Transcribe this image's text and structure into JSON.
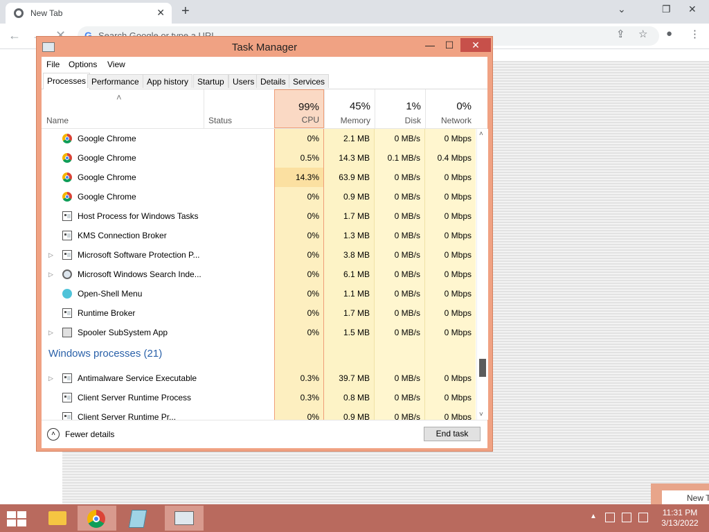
{
  "browser": {
    "tab_title": "New Tab",
    "tab_close": "✕",
    "new_tab": "+",
    "omnibox_placeholder": "Search Google or type a URL",
    "omnibox_g": "G",
    "background_card_text": "New T"
  },
  "task_manager": {
    "title": "Task Manager",
    "window_controls": {
      "minimize": "—",
      "maximize": "☐",
      "close": "✕"
    },
    "menu": [
      "File",
      "Options",
      "View"
    ],
    "tabs": [
      "Processes",
      "Performance",
      "App history",
      "Startup",
      "Users",
      "Details",
      "Services"
    ],
    "active_tab": "Processes",
    "columns": {
      "name": "Name",
      "status": "Status",
      "cpu": {
        "label": "CPU",
        "pct": "99%"
      },
      "memory": {
        "label": "Memory",
        "pct": "45%"
      },
      "disk": {
        "label": "Disk",
        "pct": "1%"
      },
      "network": {
        "label": "Network",
        "pct": "0%"
      },
      "sort_arrow": "˄"
    },
    "rows": [
      {
        "name": "Google Chrome",
        "icon": "chrome-icon",
        "expandable": false,
        "cpu": "0%",
        "mem": "2.1 MB",
        "disk": "0 MB/s",
        "net": "0 Mbps"
      },
      {
        "name": "Google Chrome",
        "icon": "chrome-icon",
        "expandable": false,
        "cpu": "0.5%",
        "mem": "14.3 MB",
        "disk": "0.1 MB/s",
        "net": "0.4 Mbps"
      },
      {
        "name": "Google Chrome",
        "icon": "chrome-icon",
        "expandable": false,
        "cpu": "14.3%",
        "mem": "63.9 MB",
        "disk": "0 MB/s",
        "net": "0 Mbps",
        "hot": true
      },
      {
        "name": "Google Chrome",
        "icon": "chrome-icon",
        "expandable": false,
        "cpu": "0%",
        "mem": "0.9 MB",
        "disk": "0 MB/s",
        "net": "0 Mbps"
      },
      {
        "name": "Host Process for Windows Tasks",
        "icon": "window-icon",
        "expandable": false,
        "cpu": "0%",
        "mem": "1.7 MB",
        "disk": "0 MB/s",
        "net": "0 Mbps"
      },
      {
        "name": "KMS Connection Broker",
        "icon": "window-icon",
        "expandable": false,
        "cpu": "0%",
        "mem": "1.3 MB",
        "disk": "0 MB/s",
        "net": "0 Mbps"
      },
      {
        "name": "Microsoft Software Protection P...",
        "icon": "window-icon",
        "expandable": true,
        "cpu": "0%",
        "mem": "3.8 MB",
        "disk": "0 MB/s",
        "net": "0 Mbps"
      },
      {
        "name": "Microsoft Windows Search Inde...",
        "icon": "search-user-icon",
        "expandable": true,
        "cpu": "0%",
        "mem": "6.1 MB",
        "disk": "0 MB/s",
        "net": "0 Mbps"
      },
      {
        "name": "Open-Shell Menu",
        "icon": "shell-icon",
        "expandable": false,
        "cpu": "0%",
        "mem": "1.1 MB",
        "disk": "0 MB/s",
        "net": "0 Mbps"
      },
      {
        "name": "Runtime Broker",
        "icon": "window-icon",
        "expandable": false,
        "cpu": "0%",
        "mem": "1.7 MB",
        "disk": "0 MB/s",
        "net": "0 Mbps"
      },
      {
        "name": "Spooler SubSystem App",
        "icon": "printer-icon",
        "expandable": true,
        "cpu": "0%",
        "mem": "1.5 MB",
        "disk": "0 MB/s",
        "net": "0 Mbps"
      }
    ],
    "group_title": "Windows processes (21)",
    "group_rows": [
      {
        "name": "Antimalware Service Executable",
        "icon": "window-icon",
        "expandable": true,
        "cpu": "0.3%",
        "mem": "39.7 MB",
        "disk": "0 MB/s",
        "net": "0 Mbps"
      },
      {
        "name": "Client Server Runtime Process",
        "icon": "window-icon",
        "expandable": false,
        "cpu": "0.3%",
        "mem": "0.8 MB",
        "disk": "0 MB/s",
        "net": "0 Mbps"
      },
      {
        "name": "Client Server Runtime Pr...",
        "icon": "window-icon",
        "expandable": false,
        "cpu": "0%",
        "mem": "0.9 MB",
        "disk": "0 MB/s",
        "net": "0 Mbps"
      }
    ],
    "footer": {
      "fewer_details": "Fewer details",
      "fewer_details_glyph": "˄",
      "end_task": "End task"
    }
  },
  "taskbar": {
    "tray_overflow": "▲",
    "time": "11:31 PM",
    "date": "3/13/2022"
  },
  "colors": {
    "accent_window": "#f0a283",
    "cpu_column": "#fad9c4",
    "group_title": "#2a61a9",
    "taskbar": "#b96a5e"
  }
}
